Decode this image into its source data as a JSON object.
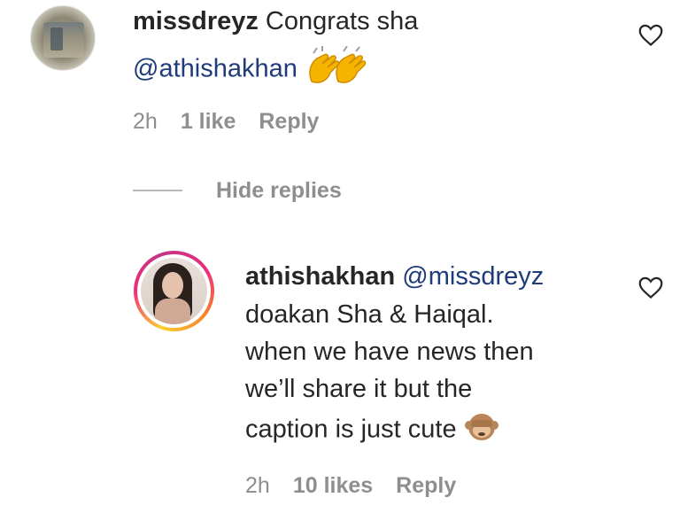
{
  "comments": [
    {
      "username": "missdreyz",
      "text_line1": " Congrats sha",
      "mention": "@athishakhan",
      "emoji": "clapping-hands",
      "time": "2h",
      "likes": "1 like",
      "reply": "Reply"
    },
    {
      "username": "athishakhan",
      "mention": " @missdreyz",
      "lines": [
        "doakan Sha & Haiqal.",
        "when we have news then",
        "we’ll share it but the",
        "caption is just cute"
      ],
      "emoji": "see-no-evil-monkey",
      "time": "2h",
      "likes": "10 likes",
      "reply": "Reply"
    }
  ],
  "thread": {
    "hide_replies": "Hide replies"
  }
}
